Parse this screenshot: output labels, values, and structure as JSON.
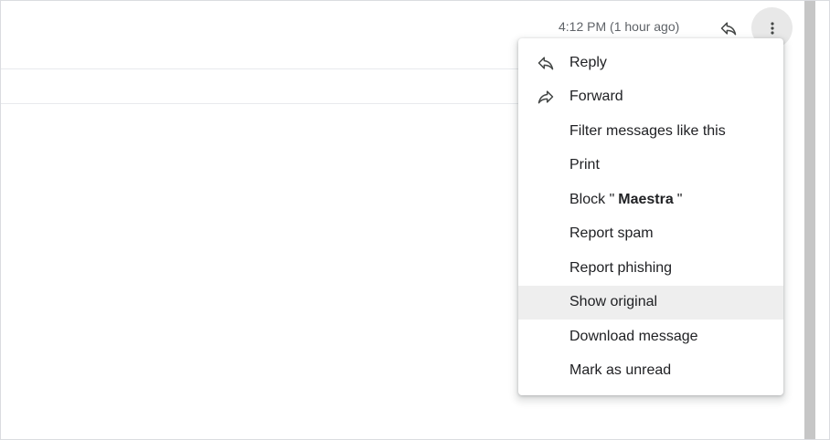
{
  "header": {
    "timestamp": "4:12 PM (1 hour ago)"
  },
  "toolbar": {
    "reply_icon": "reply-icon",
    "more_icon": "more-vert-icon"
  },
  "menu": {
    "items": [
      {
        "label": "Reply",
        "icon": "reply-icon"
      },
      {
        "label": "Forward",
        "icon": "forward-icon"
      },
      {
        "label": "Filter messages like this"
      },
      {
        "label": "Print"
      },
      {
        "label_prefix": "Block \"",
        "sender": "Maestra",
        "label_suffix": "\""
      },
      {
        "label": "Report spam"
      },
      {
        "label": "Report phishing"
      },
      {
        "label": "Show original",
        "state": "hovered"
      },
      {
        "label": "Download message"
      },
      {
        "label": "Mark as unread"
      }
    ]
  },
  "colors": {
    "text_primary": "#202124",
    "text_secondary": "#5f6368",
    "hover_bg": "#eeeeee",
    "scrollbar_thumb": "#c6c6c6"
  }
}
